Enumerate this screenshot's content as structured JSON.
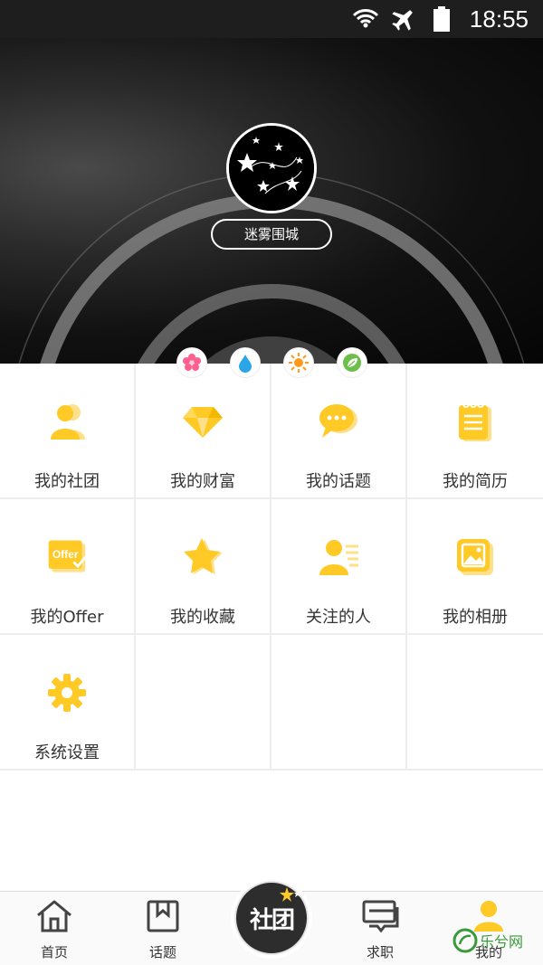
{
  "status_bar": {
    "time": "18:55",
    "icons": [
      "wifi-icon",
      "airplane-mode-icon",
      "battery-icon"
    ]
  },
  "profile": {
    "nickname": "迷雾围城",
    "badges": [
      "flower-badge-icon",
      "water-drop-badge-icon",
      "sun-badge-icon",
      "leaf-badge-icon"
    ]
  },
  "menu": {
    "items": [
      {
        "label": "我的社团",
        "icon": "club-icon"
      },
      {
        "label": "我的财富",
        "icon": "diamond-icon"
      },
      {
        "label": "我的话题",
        "icon": "chat-bubble-icon"
      },
      {
        "label": "我的简历",
        "icon": "resume-notepad-icon"
      },
      {
        "label": "我的Offer",
        "icon": "offer-icon"
      },
      {
        "label": "我的收藏",
        "icon": "star-icon"
      },
      {
        "label": "关注的人",
        "icon": "followed-person-icon"
      },
      {
        "label": "我的相册",
        "icon": "photo-album-icon"
      },
      {
        "label": "系统设置",
        "icon": "gear-icon"
      }
    ]
  },
  "bottom_nav": {
    "home": "首页",
    "topics": "话题",
    "center": "社团",
    "jobs": "求职",
    "me": "我的"
  },
  "watermark": {
    "text": "乐兮网"
  },
  "colors": {
    "accent": "#FFC926",
    "accent_dark": "#F5B800",
    "grid_border": "#EDEDED"
  }
}
